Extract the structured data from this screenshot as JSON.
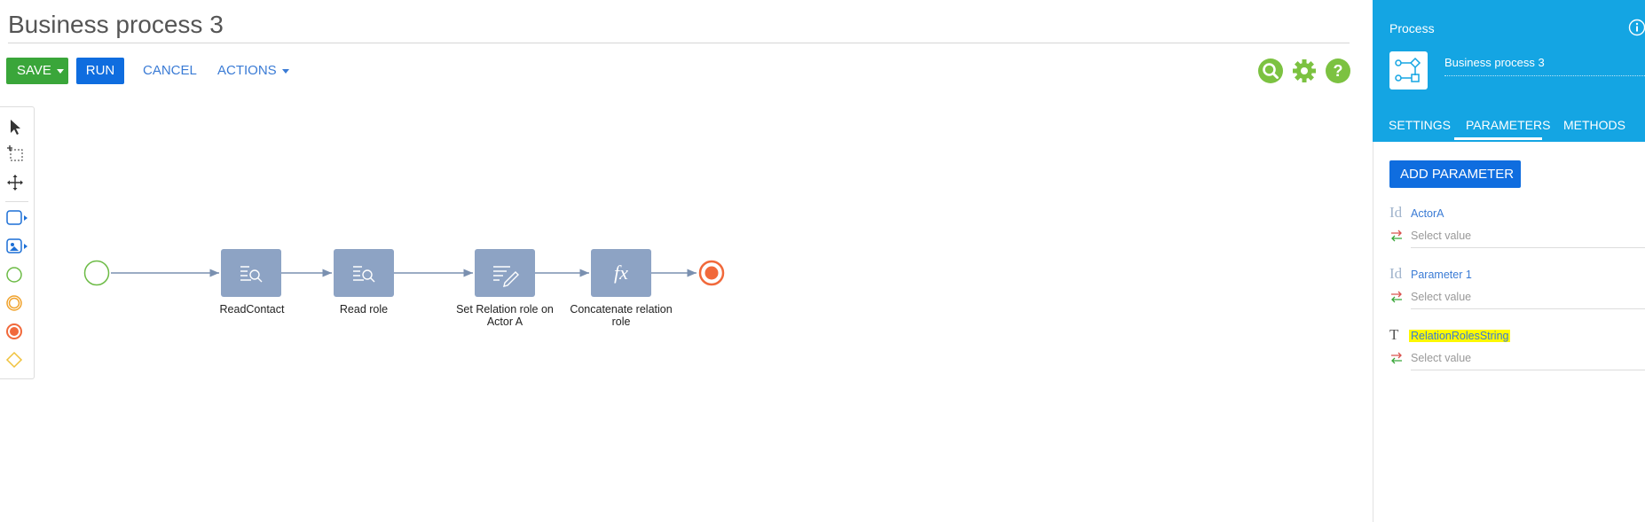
{
  "header": {
    "title": "Business process 3",
    "save_label": "SAVE",
    "run_label": "RUN",
    "cancel_label": "CANCEL",
    "actions_label": "ACTIONS",
    "tools": [
      "search-icon",
      "gear-icon",
      "help-icon"
    ]
  },
  "colors": {
    "save": "#3aa63a",
    "primary": "#0f6ddf",
    "panel_header": "#14a5e3",
    "task": "#8da3c4",
    "tool": "#7cc241",
    "end_event": "#f1693b",
    "highlight": "#fdf800"
  },
  "palette": {
    "items": [
      "pointer-icon",
      "area-select-icon",
      "pan-icon",
      "task-shape-icon",
      "image-task-icon",
      "start-event-icon",
      "intermediate-event-icon",
      "end-event-icon",
      "gateway-icon"
    ]
  },
  "diagram": {
    "elements": [
      {
        "type": "start-event"
      },
      {
        "type": "read-data",
        "label": "ReadContact"
      },
      {
        "type": "read-data",
        "label": "Read role"
      },
      {
        "type": "modify-data",
        "label": "Set Relation role on Actor A"
      },
      {
        "type": "formula",
        "label": "Concatenate relation role",
        "symbol": "fx"
      },
      {
        "type": "end-event"
      }
    ]
  },
  "panel": {
    "title": "Process",
    "info_icon": "info-icon",
    "process_name": "Business process 3",
    "tabs": [
      {
        "label": "SETTINGS",
        "active": false
      },
      {
        "label": "PARAMETERS",
        "active": true
      },
      {
        "label": "METHODS",
        "active": false
      }
    ],
    "add_parameter_label": "ADD PARAMETER",
    "parameters": [
      {
        "type_glyph": "Id",
        "name": "ActorA",
        "value_placeholder": "Select value",
        "highlighted": false
      },
      {
        "type_glyph": "Id",
        "name": "Parameter 1",
        "value_placeholder": "Select value",
        "highlighted": false
      },
      {
        "type_glyph": "T",
        "name": "RelationRolesString",
        "value_placeholder": "Select value",
        "highlighted": true
      }
    ]
  }
}
